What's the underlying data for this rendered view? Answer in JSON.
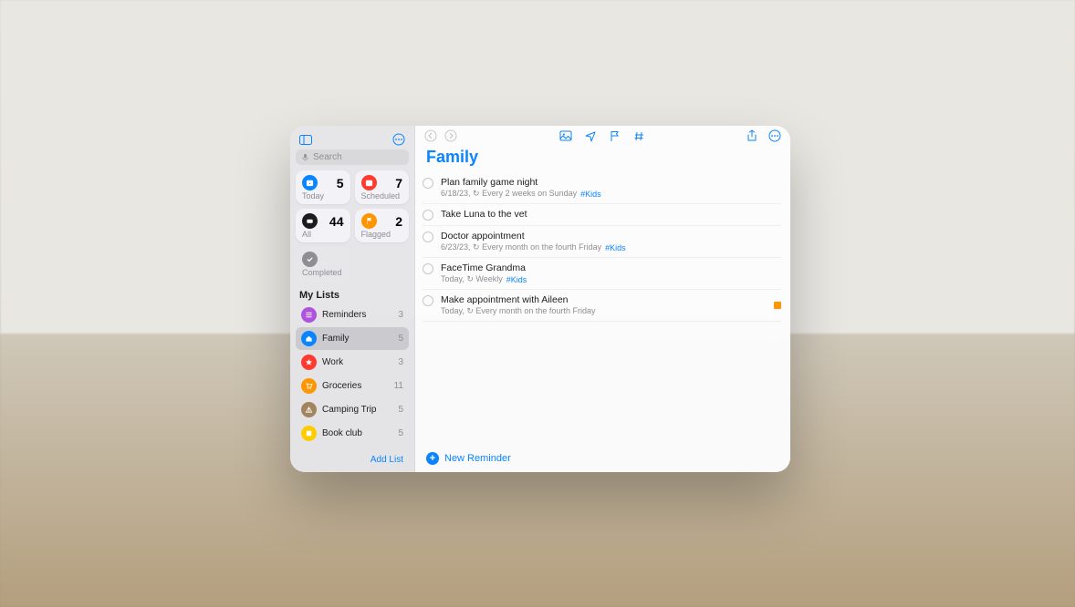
{
  "search": {
    "placeholder": "Search"
  },
  "smart": {
    "today": {
      "label": "Today",
      "count": 5,
      "color": "#0a84ff"
    },
    "scheduled": {
      "label": "Scheduled",
      "count": 7,
      "color": "#ff3b30"
    },
    "all": {
      "label": "All",
      "count": 44,
      "color": "#1c1c1e"
    },
    "flagged": {
      "label": "Flagged",
      "count": 2,
      "color": "#ff9500"
    },
    "completed": {
      "label": "Completed"
    }
  },
  "my_lists_header": "My Lists",
  "lists": [
    {
      "name": "Reminders",
      "count": 3,
      "color": "#af52de",
      "icon": "list"
    },
    {
      "name": "Family",
      "count": 5,
      "color": "#0a84ff",
      "icon": "house",
      "active": true
    },
    {
      "name": "Work",
      "count": 3,
      "color": "#ff3b30",
      "icon": "star"
    },
    {
      "name": "Groceries",
      "count": 11,
      "color": "#ff9500",
      "icon": "cart"
    },
    {
      "name": "Camping Trip",
      "count": 5,
      "color": "#a2845e",
      "icon": "tent"
    },
    {
      "name": "Book club",
      "count": 5,
      "color": "#ffcc00",
      "icon": "book"
    }
  ],
  "add_list_label": "Add List",
  "list_title": "Family",
  "reminders": [
    {
      "title": "Plan family game night",
      "sub": "6/18/23, ↻ Every 2 weeks on Sunday",
      "tag": "#Kids"
    },
    {
      "title": "Take Luna to the vet",
      "sub": ""
    },
    {
      "title": "Doctor appointment",
      "sub": "6/23/23, ↻ Every month on the fourth Friday",
      "tag": "#Kids"
    },
    {
      "title": "FaceTime Grandma",
      "sub": "Today, ↻ Weekly",
      "tag": "#Kids"
    },
    {
      "title": "Make appointment with Aileen",
      "sub": "Today, ↻ Every month on the fourth Friday",
      "flagged": true
    }
  ],
  "new_reminder_label": "New Reminder"
}
